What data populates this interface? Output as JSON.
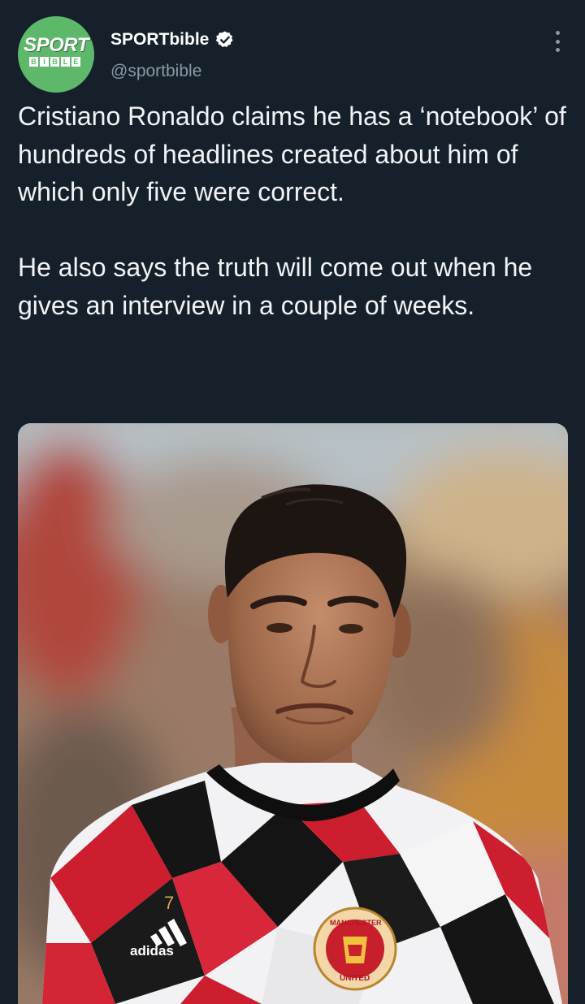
{
  "account": {
    "display_name": "SPORTbible",
    "handle": "@sportbible",
    "verified": true,
    "avatar": {
      "logo_top": "SPORT",
      "logo_bottom_letters": [
        "B",
        "I",
        "B",
        "L",
        "E"
      ],
      "bg_color": "#5db86a"
    }
  },
  "tweet": {
    "text": "Cristiano Ronaldo claims he has a ‘notebook’ of hundreds of headlines created about him of which only five were correct.\n\nHe also says the truth will come out when he gives an interview in a couple of weeks."
  },
  "media": {
    "shirt_brand": "adidas",
    "crest_text_top": "MANCHESTER",
    "crest_text_bottom": "UNITED",
    "shirt_number": "7"
  },
  "icons": {
    "verified": "verified-badge-icon",
    "more": "more-options-icon"
  },
  "colors": {
    "background": "#15202b",
    "text": "#f2f3f5",
    "secondary": "#8b98a5"
  }
}
